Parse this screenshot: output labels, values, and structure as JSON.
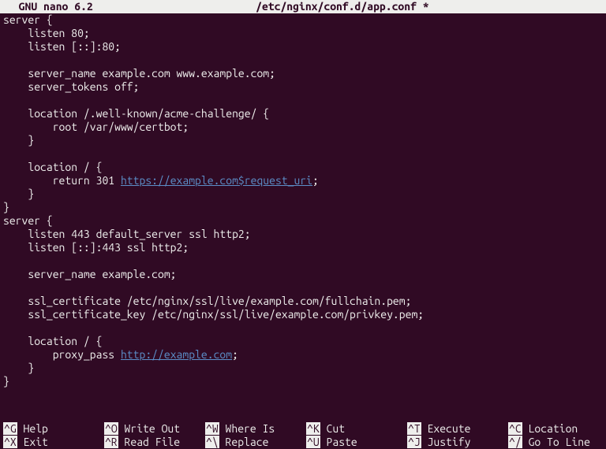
{
  "titlebar": {
    "app": "  GNU nano 6.2",
    "filename": "/etc/nginx/conf.d/app.conf *"
  },
  "lines": [
    {
      "pre": "server {"
    },
    {
      "pre": "    listen 80;"
    },
    {
      "pre": "    listen [::]:80;"
    },
    {
      "pre": ""
    },
    {
      "pre": "    server_name example.com www.example.com;"
    },
    {
      "pre": "    server_tokens off;"
    },
    {
      "pre": ""
    },
    {
      "pre": "    location /.well-known/acme-challenge/ {"
    },
    {
      "pre": "        root /var/www/certbot;"
    },
    {
      "pre": "    }"
    },
    {
      "pre": ""
    },
    {
      "pre": "    location / {"
    },
    {
      "pre": "        return 301 ",
      "url": "https://example.com$request_uri",
      "post": ";"
    },
    {
      "pre": "    }"
    },
    {
      "pre": "}"
    },
    {
      "pre": "server {"
    },
    {
      "pre": "    listen 443 default_server ssl http2;"
    },
    {
      "pre": "    listen [::]:443 ssl http2;"
    },
    {
      "pre": ""
    },
    {
      "pre": "    server_name example.com;"
    },
    {
      "pre": ""
    },
    {
      "pre": "    ssl_certificate /etc/nginx/ssl/live/example.com/fullchain.pem;"
    },
    {
      "pre": "    ssl_certificate_key /etc/nginx/ssl/live/example.com/privkey.pem;"
    },
    {
      "pre": ""
    },
    {
      "pre": "    location / {"
    },
    {
      "pre": "        proxy_pass ",
      "url": "http://example.com",
      "post": ";"
    },
    {
      "pre": "    }"
    },
    {
      "pre": "}"
    },
    {
      "pre": ""
    }
  ],
  "help": {
    "row1": [
      {
        "key": "^G",
        "label": " Help"
      },
      {
        "key": "^O",
        "label": " Write Out"
      },
      {
        "key": "^W",
        "label": " Where Is"
      },
      {
        "key": "^K",
        "label": " Cut"
      },
      {
        "key": "^T",
        "label": " Execute"
      },
      {
        "key": "^C",
        "label": " Location"
      }
    ],
    "row2": [
      {
        "key": "^X",
        "label": " Exit"
      },
      {
        "key": "^R",
        "label": " Read File"
      },
      {
        "key": "^\\",
        "label": " Replace"
      },
      {
        "key": "^U",
        "label": " Paste"
      },
      {
        "key": "^J",
        "label": " Justify"
      },
      {
        "key": "^/",
        "label": " Go To Line"
      }
    ]
  }
}
